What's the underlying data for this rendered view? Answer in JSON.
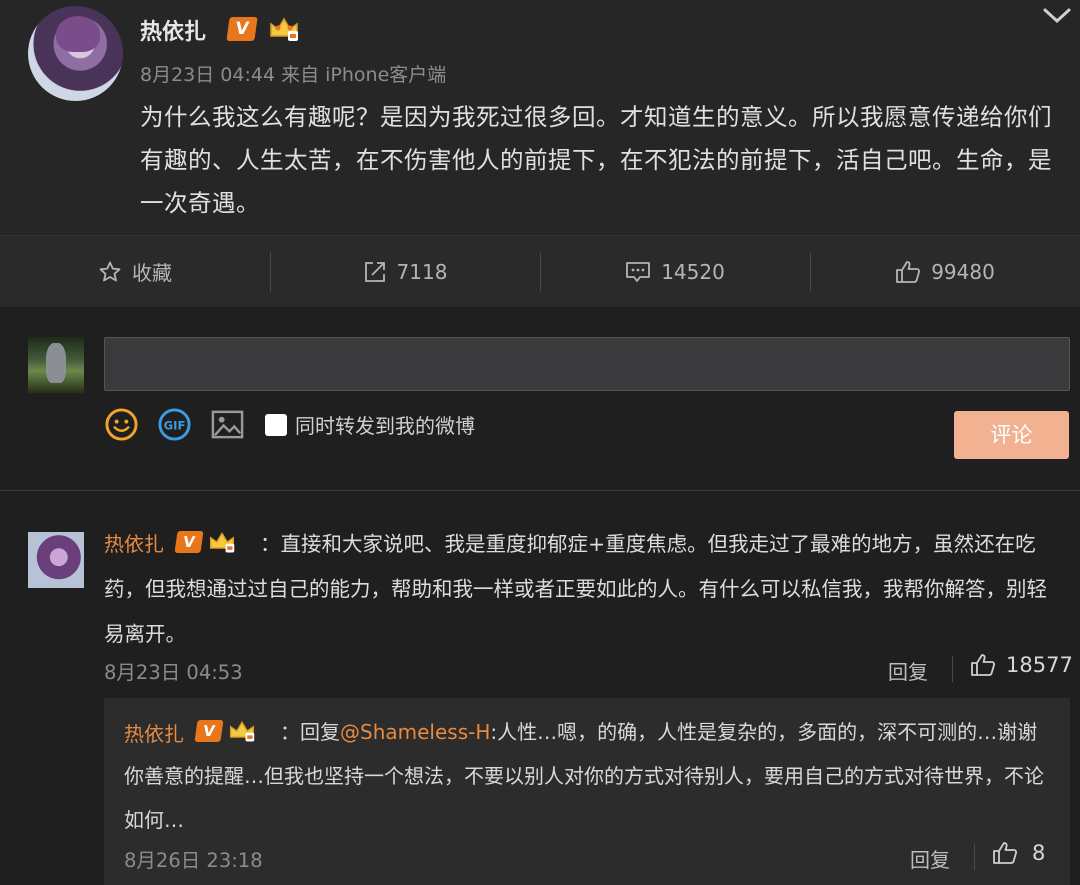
{
  "post": {
    "author": "热依扎",
    "meta": "8月23日 04:44 来自 iPhone客户端",
    "text": "为什么我这么有趣呢？是因为我死过很多回。才知道生的意义。所以我愿意传递给你们有趣的、人生太苦，在不伤害他人的前提下，在不犯法的前提下，活自己吧。生命，是一次奇遇。",
    "verified_badge": "V",
    "icons": [
      "verified-v-icon",
      "vip-crown-icon",
      "chevron-down-icon"
    ]
  },
  "actions": {
    "favorite_label": "收藏",
    "repost_count": "7118",
    "comment_count": "14520",
    "like_count": "99480",
    "icons": [
      "star-icon",
      "repost-icon",
      "comment-icon",
      "thumbs-up-icon"
    ]
  },
  "composer": {
    "input_value": "",
    "repost_option_label": "同时转发到我的微博",
    "submit_label": "评论",
    "tool_icons": [
      "emoji-icon",
      "gif-icon",
      "image-icon"
    ]
  },
  "comment": {
    "author": "热依扎",
    "text": "：直接和大家说吧、我是重度抑郁症+重度焦虑。但我走过了最难的地方，虽然还在吃药，但我想通过过自己的能力，帮助和我一样或者正要如此的人。有什么可以私信我，我帮你解答，别轻易离开。",
    "time": "8月23日 04:53",
    "reply_label": "回复",
    "like_count": "18577"
  },
  "reply": {
    "author": "热依扎",
    "prefix": "：回复",
    "mention": "@Shameless-H",
    "text": ":人性…嗯，的确，人性是复杂的，多面的，深不可测的…谢谢你善意的提醒…但我也坚持一个想法，不要以别人对你的方式对待别人，要用自己的方式对待世界，不论如何…",
    "time": "8月26日 23:18",
    "reply_label": "回复",
    "like_count": "8"
  },
  "colors": {
    "background": "#1f1f1f",
    "accent_name": "#e88a3f",
    "verified_badge": "#e8761a",
    "submit_button": "#f2b191"
  }
}
